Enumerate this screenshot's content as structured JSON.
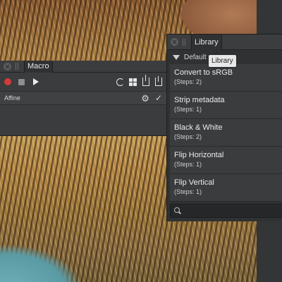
{
  "library": {
    "tab": "Library",
    "category": "Default",
    "tooltip": "Library",
    "items": [
      {
        "name": "Convert to sRGB",
        "steps": "(Steps: 2)"
      },
      {
        "name": "Strip metadata",
        "steps": "(Steps: 1)"
      },
      {
        "name": "Black & White",
        "steps": "(Steps: 2)"
      },
      {
        "name": "Flip Horizontal",
        "steps": "(Steps: 1)"
      },
      {
        "name": "Flip Vertical",
        "steps": "(Steps: 1)"
      }
    ],
    "search_placeholder": ""
  },
  "macro": {
    "tab": "Macro",
    "step_label": "Affine"
  },
  "icons": {
    "record": "record-icon",
    "stop": "stop-icon",
    "play": "play-icon",
    "refresh": "refresh-icon",
    "grid": "grid-icon",
    "export": "export-icon",
    "import": "import-icon",
    "settings": "gear-icon",
    "enabled": "check-icon",
    "search": "search-icon"
  },
  "colors": {
    "record": "#d43a3a",
    "panel": "#3a3c3e"
  }
}
